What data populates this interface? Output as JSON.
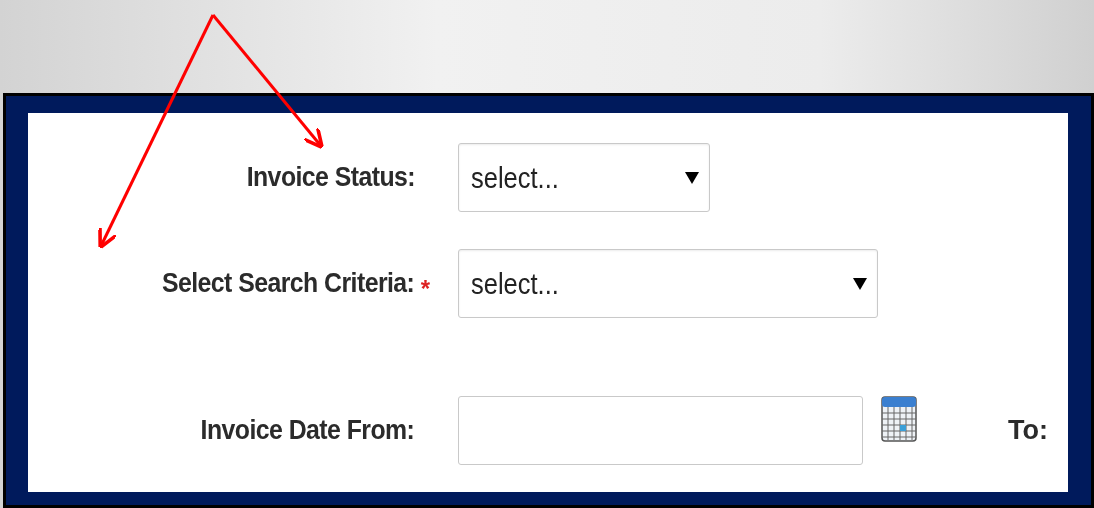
{
  "required_mark": "*",
  "fields": [
    {
      "kind": "select",
      "label": "Invoice Status:",
      "value": "select...",
      "required": false
    },
    {
      "kind": "select",
      "label": "Select Search Criteria:",
      "value": "select...",
      "required": true
    },
    {
      "kind": "date",
      "label": "Invoice Date From:",
      "required": false
    }
  ],
  "to_label": "To:"
}
